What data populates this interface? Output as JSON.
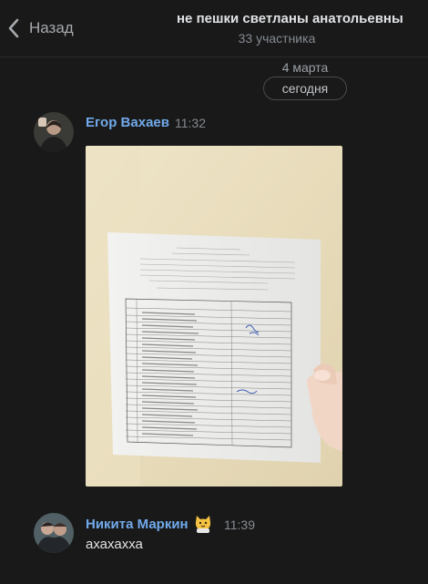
{
  "header": {
    "back_label": "Назад",
    "title": "не пешки светланы анатольевны",
    "subtitle": "33 участника"
  },
  "date_separator": {
    "date": "4 марта",
    "today": "сегодня"
  },
  "messages": [
    {
      "author": "Егор Вахаев",
      "time": "11:32",
      "attachment": "photo-of-attendance-sheet"
    },
    {
      "author": "Никита Маркин",
      "badge_icon": "cat-emoji-icon",
      "time": "11:39",
      "text": "ахахахха"
    }
  ],
  "colors": {
    "background": "#191919",
    "author_link": "#71aaeb",
    "text": "#e1e3e6",
    "muted": "#858a90"
  }
}
